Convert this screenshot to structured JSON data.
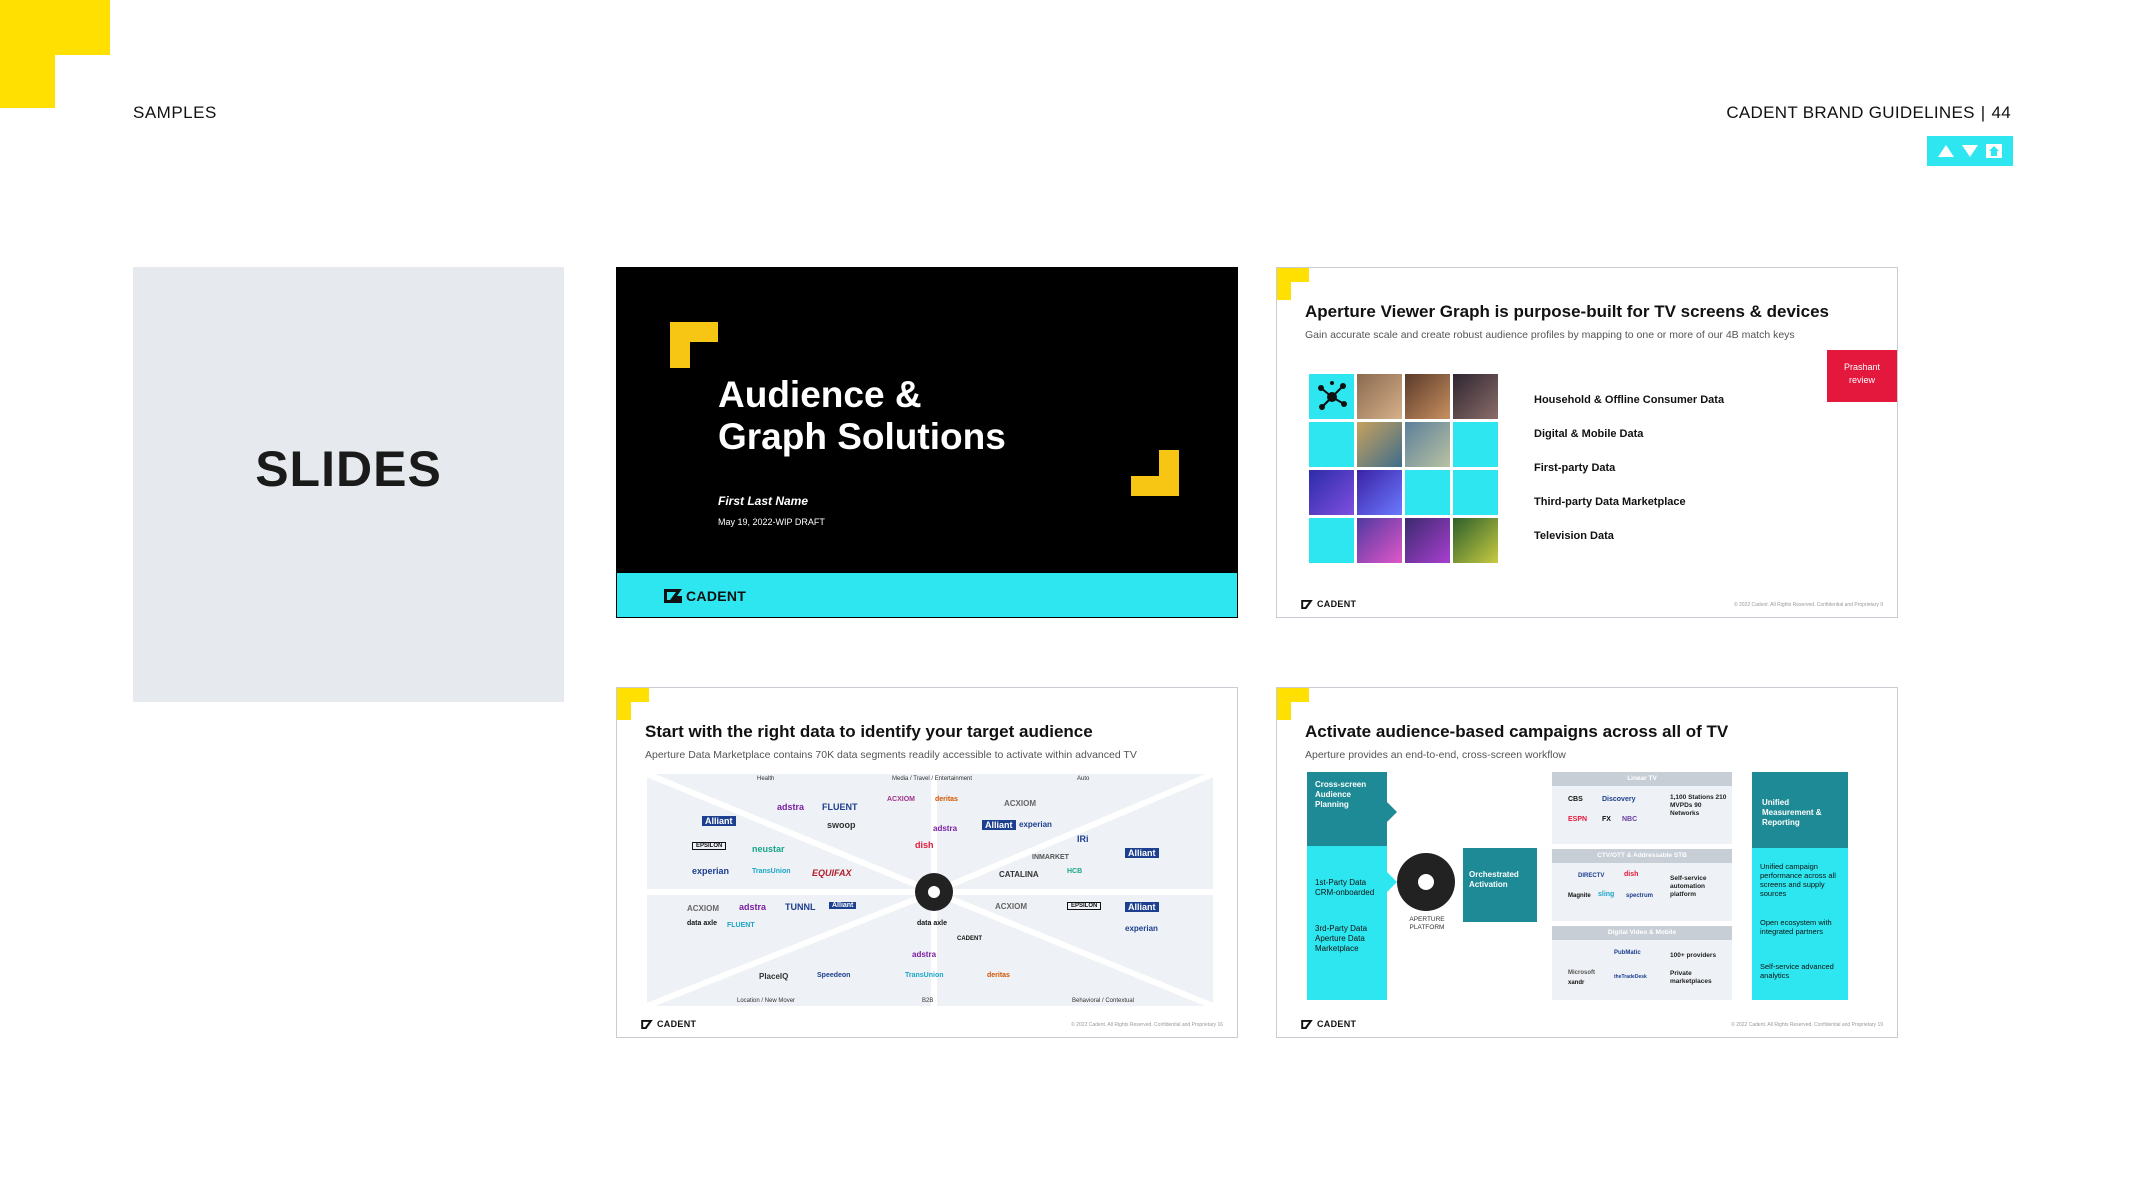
{
  "header": {
    "section": "SAMPLES",
    "doc_title": "CADENT BRAND GUIDELINES",
    "separator": "|",
    "page_number": "44"
  },
  "nav_icons": [
    "up-arrow-icon",
    "down-arrow-icon",
    "home-icon"
  ],
  "colors": {
    "yellow": "#ffe000",
    "cyan": "#2ee6ef",
    "teal": "#1e8a96",
    "red": "#e3183c"
  },
  "section_card": {
    "title": "SLIDES"
  },
  "slide1": {
    "title_line1": "Audience &",
    "title_line2": "Graph Solutions",
    "presenter": "First Last Name",
    "date": "May 19, 2022-WIP DRAFT",
    "logo": "CADENT"
  },
  "slide2": {
    "title": "Aperture Viewer Graph is purpose-built for TV screens & devices",
    "subtitle": "Gain accurate scale and create robust audience profiles by mapping to one or more of our 4B match keys",
    "items": [
      "Household & Offline Consumer Data",
      "Digital & Mobile Data",
      "First-party Data",
      "Third-party Data Marketplace",
      "Television Data"
    ],
    "badge_line1": "Prashant",
    "badge_line2": "review",
    "logo": "CADENT",
    "footer": "© 2022 Cadent. All Rights Reserved. Confidential and Proprietary",
    "page": "9"
  },
  "slide3": {
    "title": "Start with the right data to identify your target audience",
    "subtitle": "Aperture Data Marketplace contains 70K data segments readily accessible to activate within advanced TV",
    "categories_top": [
      "Health",
      "Media / Travel / Entertainment",
      "Auto"
    ],
    "categories_bottom": [
      "Location / New Mover",
      "B2B",
      "Behavioral / Contextual"
    ],
    "brands": [
      "adstra",
      "FLUENT",
      "ACXIOM",
      "deritas",
      "ACXIOM",
      "Alliant",
      "swoop",
      "adstra",
      "Alliant",
      "experian",
      "IRi",
      "EPSILON",
      "neustar",
      "dish",
      "INMARKET",
      "Alliant",
      "experian",
      "TransUnion",
      "EQUIFAX",
      "CATALINA",
      "HCB",
      "ACXIOM",
      "adstra",
      "TUNNL",
      "Alliant",
      "ACXIOM",
      "EPSILON",
      "Alliant",
      "data axle",
      "FLUENT",
      "data axle",
      "CADENT",
      "PlaceIQ",
      "Speedeon",
      "TransUnion",
      "experian",
      "deritas",
      "adstra"
    ],
    "logo": "CADENT",
    "footer": "© 2022 Cadent. All Rights Reserved. Confidential and Proprietary",
    "page": "16"
  },
  "slide4": {
    "title": "Activate audience-based campaigns across all of TV",
    "subtitle": "Aperture provides an end-to-end, cross-screen workflow",
    "left_top": "Cross-screen Audience Planning",
    "left_mid": "1st-Party Data CRM-onboarded",
    "left_bottom": "3rd-Party Data Aperture Data Marketplace",
    "platform_label": "APERTURE PLATFORM",
    "orchestrated": "Orchestrated Activation",
    "linear_header": "Linear TV",
    "linear_stats": "1,100 Stations 210 MVPDs 90 Networks",
    "linear_brands": [
      "CBS",
      "Discovery",
      "ESPN",
      "FX",
      "NBC"
    ],
    "ctv_header": "CTV/OTT & Addressable STB",
    "ctv_note": "Self-service automation platform",
    "ctv_brands": [
      "DIRECTV",
      "dish",
      "Magnite",
      "sling",
      "spectrum"
    ],
    "digital_header": "Digital Video & Mobile",
    "digital_note1": "100+ providers",
    "digital_note2": "Private marketplaces",
    "digital_brands": [
      "PubMatic",
      "Microsoft",
      "xandr",
      "theTradeDesk"
    ],
    "right_top": "Unified Measurement & Reporting",
    "right_1": "Unified campaign performance across all screens and supply sources",
    "right_2": "Open ecosystem with integrated partners",
    "right_3": "Self-service advanced analytics",
    "logo": "CADENT",
    "footer": "© 2022 Cadent. All Rights Reserved. Confidential and Proprietary",
    "page": "19"
  }
}
